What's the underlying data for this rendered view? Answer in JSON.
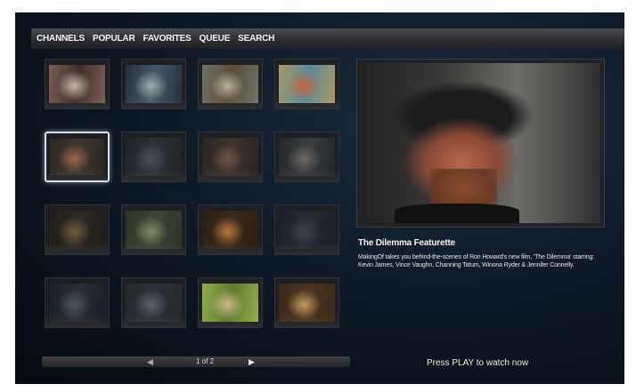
{
  "nav": {
    "items": [
      {
        "label": "CHANNELS"
      },
      {
        "label": "POPULAR"
      },
      {
        "label": "FAVORITES"
      },
      {
        "label": "QUEUE"
      },
      {
        "label": "SEARCH"
      }
    ]
  },
  "grid": {
    "columns": 4,
    "rows": 4,
    "selected_index": 4,
    "thumbnails": [
      {
        "colors": [
          "#7a5e55",
          "#c8b9ad",
          "#3e2f2a"
        ]
      },
      {
        "colors": [
          "#24313b",
          "#9fa9ad",
          "#485863"
        ]
      },
      {
        "colors": [
          "#6d7366",
          "#b8b39a",
          "#5a4b3a"
        ]
      },
      {
        "colors": [
          "#a89a62",
          "#c8643a",
          "#5b8a9a"
        ]
      },
      {
        "colors": [
          "#2b2622",
          "#a0654a",
          "#3f3832"
        ]
      },
      {
        "colors": [
          "#1f2429",
          "#4a5259",
          "#2e3338"
        ]
      },
      {
        "colors": [
          "#2a2522",
          "#6b5446",
          "#3e3430"
        ]
      },
      {
        "colors": [
          "#23272b",
          "#6a6660",
          "#3a3d40"
        ]
      },
      {
        "colors": [
          "#1e1c1a",
          "#6d5c3e",
          "#2f2a24"
        ]
      },
      {
        "colors": [
          "#2f3429",
          "#7c8b68",
          "#3d4533"
        ]
      },
      {
        "colors": [
          "#2a1f15",
          "#b3783a",
          "#3b2a1c"
        ]
      },
      {
        "colors": [
          "#1c2026",
          "#3a434c",
          "#272c33"
        ]
      },
      {
        "colors": [
          "#1a1d21",
          "#4d5560",
          "#2b3038"
        ]
      },
      {
        "colors": [
          "#24282c",
          "#5c6066",
          "#2e3238"
        ]
      },
      {
        "colors": [
          "#8fae4d",
          "#cdb78b",
          "#5f7a2c"
        ]
      },
      {
        "colors": [
          "#3a2a1a",
          "#c29a5a",
          "#4b3520"
        ]
      }
    ]
  },
  "preview": {
    "title": "The Dilemma Featurette",
    "description": "MakingOf takes you behind-the-scenes of Ron Howard's new film, 'The Dilemma' starring: Kevin James, Vince Vaughn, Channing Tatum, Winona Ryder & Jennifer Connelly."
  },
  "pager": {
    "label": "1 of 2",
    "prev_icon": "prev-arrow-icon",
    "next_icon": "next-arrow-icon"
  },
  "hint": "Press PLAY to watch now",
  "colors": {
    "background": "#0f1a26",
    "navbar": "#2c2e32",
    "selected_border": "#d9dde3",
    "text": "#f4f4f4"
  }
}
